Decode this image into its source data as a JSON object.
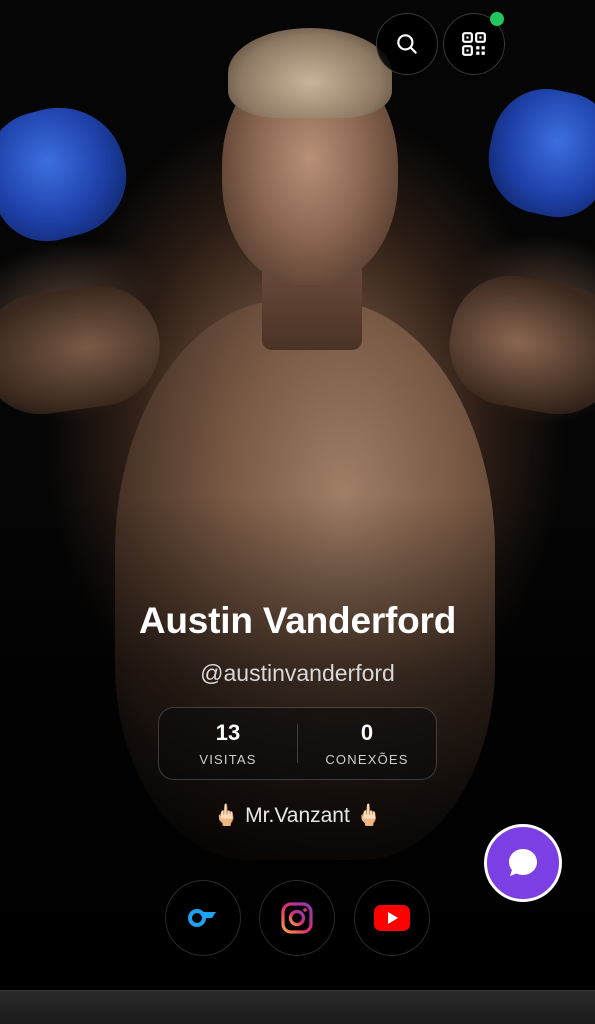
{
  "profile": {
    "name": "Austin Vanderford",
    "handle": "@austinvanderford",
    "bio": "🖕🏻 Mr.Vanzant 🖕🏻"
  },
  "stats": [
    {
      "value": "13",
      "label": "VISITAS"
    },
    {
      "value": "0",
      "label": "CONEXÕES"
    }
  ],
  "header": {
    "buttons": [
      {
        "icon": "search-icon"
      },
      {
        "icon": "qr-code-icon"
      }
    ],
    "status_dot_color": "#22c55e"
  },
  "socials": [
    {
      "icon": "onlyfans-icon",
      "color": "#1da1f2"
    },
    {
      "icon": "instagram-icon",
      "color": "#e1306c"
    },
    {
      "icon": "youtube-icon",
      "color": "#ff0000"
    }
  ],
  "chat_button": {
    "icon": "chat-bubble-icon",
    "color": "#7b3fe4"
  }
}
